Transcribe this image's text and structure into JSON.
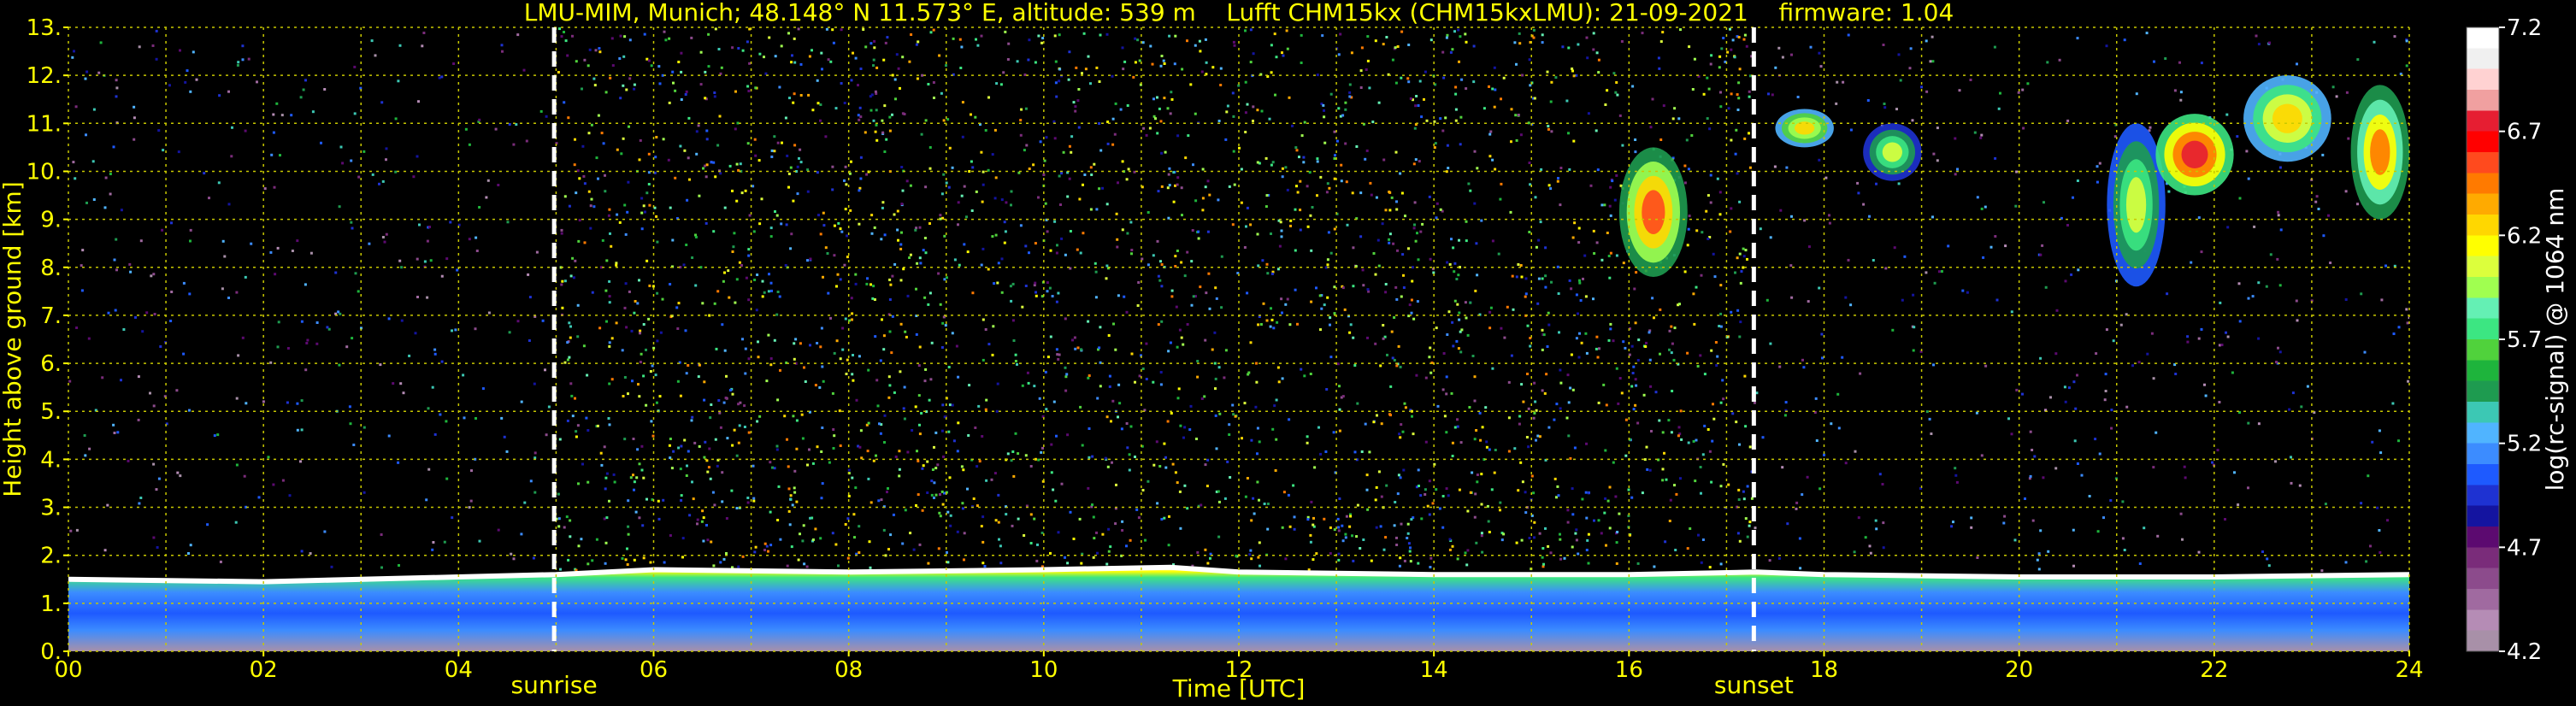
{
  "chart_data": {
    "type": "heatmap",
    "title": "LMU-MIM, Munich; 48.148° N 11.573° E, altitude: 539 m    Lufft CHM15kx (CHM15kxLMU): 21-09-2021    firmware: 1.04",
    "xlabel": "Time [UTC]",
    "ylabel": "Height above ground [km]",
    "xlim": [
      0,
      24
    ],
    "ylim": [
      0,
      13
    ],
    "x_ticks": [
      "00",
      "02",
      "04",
      "06",
      "08",
      "10",
      "12",
      "14",
      "16",
      "18",
      "20",
      "22",
      "24"
    ],
    "y_ticks": [
      "0.",
      "1.",
      "2.",
      "3.",
      "4.",
      "5.",
      "6.",
      "7.",
      "8.",
      "9.",
      "10.",
      "11.",
      "12.",
      "13."
    ],
    "grid": true,
    "markers": [
      {
        "label": "sunrise",
        "x": 4.98
      },
      {
        "label": "sunset",
        "x": 17.28
      }
    ],
    "colorbar": {
      "label": "log(rc-signal) @ 1064 nm",
      "ticks": [
        "4.2",
        "4.7",
        "5.2",
        "5.7",
        "6.2",
        "6.7",
        "7.2"
      ],
      "range": [
        4.2,
        7.2
      ],
      "colors": [
        "#a890a8",
        "#b58cb5",
        "#a06aa0",
        "#8c4b8c",
        "#7a2c7a",
        "#5c0a70",
        "#1414a0",
        "#1e32d2",
        "#1e5aff",
        "#3c8cff",
        "#50b4ff",
        "#3cc8b4",
        "#1e9b50",
        "#1eb43c",
        "#50d23c",
        "#3ce682",
        "#64f0b4",
        "#a0ff50",
        "#dcff3c",
        "#ffff00",
        "#ffd700",
        "#ffaa00",
        "#ff7a00",
        "#ff4a1e",
        "#ff0000",
        "#e61e32",
        "#f0a0a0",
        "#ffd2d2",
        "#f0f0f0",
        "#ffffff"
      ]
    },
    "layers": [
      {
        "name": "",
        "x": [
          0,
          2,
          4,
          5,
          6,
          8,
          10,
          11.3,
          12,
          14,
          16,
          17.3,
          18,
          20,
          22,
          24
        ],
        "top": [
          1.5,
          1.45,
          1.55,
          1.6,
          1.7,
          1.65,
          1.7,
          1.75,
          1.65,
          1.6,
          1.6,
          1.65,
          1.6,
          1.55,
          1.55,
          1.6
        ]
      },
      {
        "name": "",
        "clouds": [
          {
            "x": [
              15.9,
              16.6
            ],
            "y": [
              7.8,
              10.5
            ],
            "peak": 6.5
          },
          {
            "x": [
              17.5,
              18.1
            ],
            "y": [
              10.5,
              11.3
            ],
            "peak": 6.2
          },
          {
            "x": [
              18.4,
              19.0
            ],
            "y": [
              9.8,
              11.0
            ],
            "peak": 6.0
          },
          {
            "x": [
              20.9,
              21.5
            ],
            "y": [
              7.6,
              11.0
            ],
            "peak": 6.1
          },
          {
            "x": [
              21.4,
              22.2
            ],
            "y": [
              9.5,
              11.2
            ],
            "peak": 6.7
          },
          {
            "x": [
              22.3,
              23.2
            ],
            "y": [
              10.2,
              12.0
            ],
            "peak": 6.3
          },
          {
            "x": [
              23.4,
              24.0
            ],
            "y": [
              9.0,
              11.8
            ],
            "peak": 6.4
          }
        ]
      }
    ]
  }
}
